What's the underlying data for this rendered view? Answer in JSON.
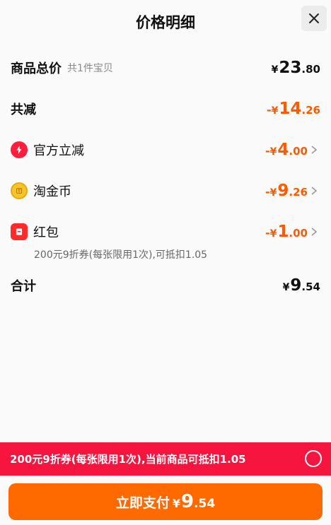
{
  "header": {
    "title": "价格明细"
  },
  "summary": {
    "total_label": "商品总价",
    "total_sub": "共1件宝贝",
    "total_yen": "¥",
    "total_int": "23",
    "total_dec": ".80"
  },
  "reduction": {
    "label": "共减",
    "sign": "-",
    "yen": "¥",
    "int": "14",
    "dec": ".26"
  },
  "items": [
    {
      "icon": "lightning-icon",
      "label": "官方立减",
      "sign": "-",
      "yen": "¥",
      "int": "4",
      "dec": ".00"
    },
    {
      "icon": "coin-icon",
      "label": "淘金币",
      "sign": "-",
      "yen": "¥",
      "int": "9",
      "dec": ".26"
    },
    {
      "icon": "red-packet-icon",
      "label": "红包",
      "sign": "-",
      "yen": "¥",
      "int": "1",
      "dec": ".00",
      "note": "200元9折券(每张限用1次),可抵扣1.05"
    }
  ],
  "subtotal": {
    "label": "合计",
    "yen": "¥",
    "int": "9",
    "dec": ".54"
  },
  "promo": {
    "text": "200元9折券(每张限用1次),当前商品可抵扣1.05"
  },
  "pay": {
    "label": "立即支付",
    "yen": "¥",
    "int": "9",
    "dec": ".54"
  },
  "colors": {
    "accent_orange": "#ff5a00",
    "promo_red": "#f5153e",
    "pay_orange": "#ff6a00"
  }
}
